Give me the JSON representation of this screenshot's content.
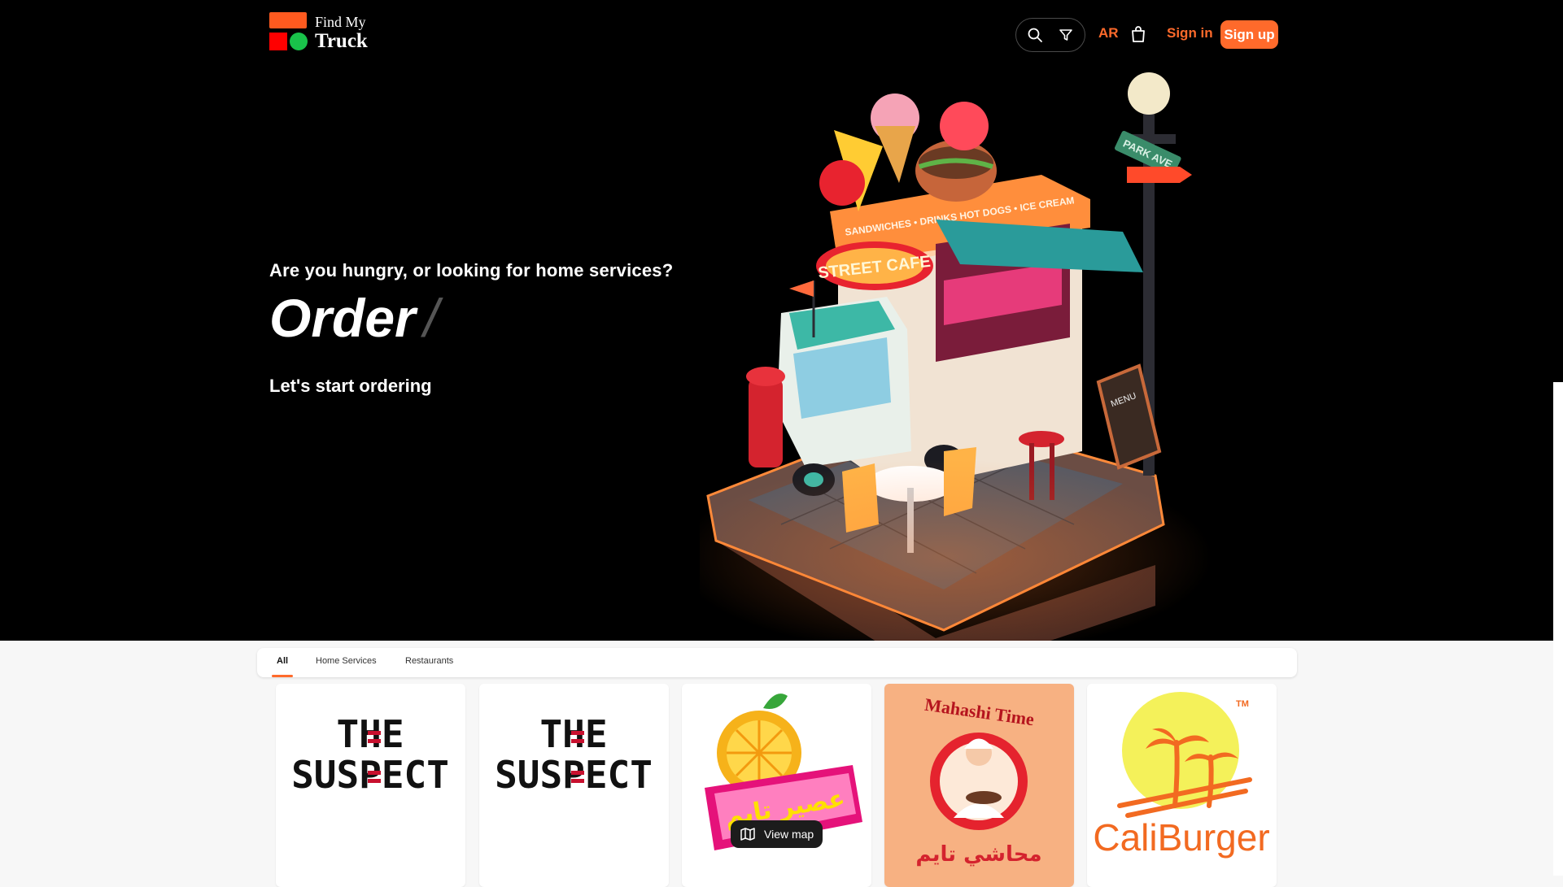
{
  "brand": {
    "line1": "Find My",
    "line2": "Truck",
    "colors": {
      "square_orange": "#ff5a1f",
      "square_red": "#ff0000",
      "dot_green": "#19c24a"
    }
  },
  "header": {
    "search_icon": "search-icon",
    "filter_icon": "filter-icon",
    "language": "AR",
    "bag_icon": "shopping-bag-icon",
    "sign_in": "Sign in",
    "sign_up": "Sign up",
    "accent": "#ff6a2b"
  },
  "hero": {
    "question": "Are you hungry, or looking for home services?",
    "rotating_word": "Order",
    "caret": "/",
    "subtitle": "Let's start ordering",
    "illustration": {
      "truck_sign": "STREET CAFE",
      "roof_sign": "SANDWICHES • DRINKS    HOT DOGS • ICE CREAM",
      "street_sign": "PARK AVE",
      "menu_board": "MENU"
    }
  },
  "tabs": [
    {
      "label": "All",
      "active": true
    },
    {
      "label": "Home Services",
      "active": false
    },
    {
      "label": "Restaurants",
      "active": false
    }
  ],
  "cards": [
    {
      "name": "The Suspect",
      "logo_line1": "THE",
      "logo_line2": "SUSPECT"
    },
    {
      "name": "The Suspect",
      "logo_line1": "THE",
      "logo_line2": "SUSPECT"
    },
    {
      "name": "Juice Time",
      "logo_text": "عصير تايم"
    },
    {
      "name": "Mahashi Time",
      "logo_text_en": "Mahashi Time",
      "logo_text_ar": "محاشي تايم"
    },
    {
      "name": "CaliBurger",
      "logo_text": "CaliBurger",
      "trademark": "TM"
    }
  ],
  "view_map": {
    "label": "View map",
    "icon": "map-icon"
  }
}
